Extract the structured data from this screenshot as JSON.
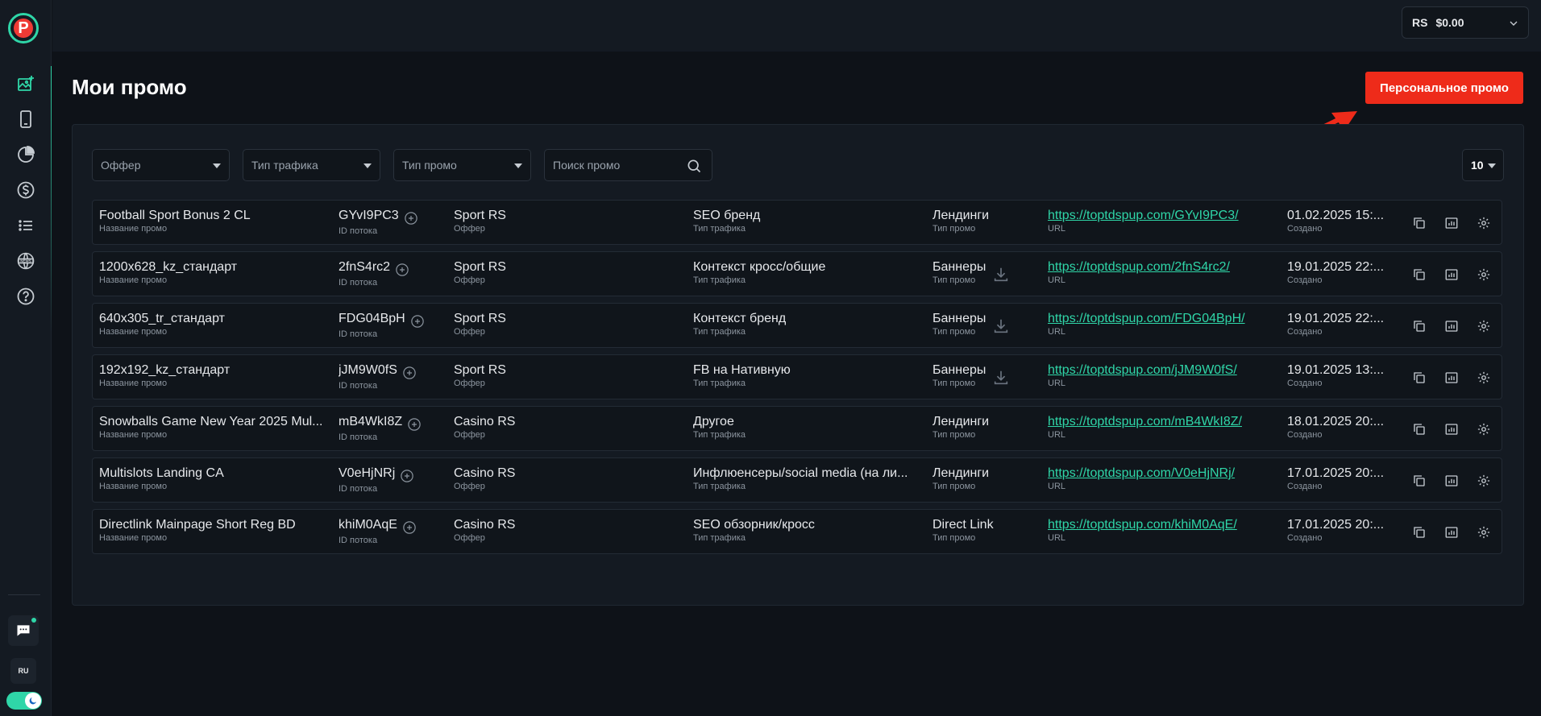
{
  "sidebar": {
    "logo_letter": "P",
    "nav": [
      "promo-icon",
      "mobile-icon",
      "pie-chart-icon",
      "dollar-icon",
      "list-icon",
      "news-icon",
      "help-icon"
    ],
    "lang": "RU"
  },
  "topbar": {
    "currency": "RS",
    "balance": "$0.00"
  },
  "page": {
    "title": "Мои промо",
    "personal_promo_button": "Персональное промо"
  },
  "filters": {
    "offer_placeholder": "Оффер",
    "traffic_placeholder": "Тип трафика",
    "promo_type_placeholder": "Тип промо",
    "search_placeholder": "Поиск промо",
    "per_page": "10"
  },
  "labels": {
    "name": "Название промо",
    "stream_id": "ID потока",
    "offer": "Оффер",
    "traffic": "Тип трафика",
    "promo_type": "Тип промо",
    "url": "URL",
    "created": "Создано"
  },
  "rows": [
    {
      "name": "Football Sport Bonus 2 CL",
      "id": "GYvI9PC3",
      "offer": "Sport RS",
      "traffic": "SEO бренд",
      "type": "Лендинги",
      "download": false,
      "url": "https://toptdspup.com/GYvI9PC3/",
      "date": "01.02.2025 15:..."
    },
    {
      "name": "1200x628_kz_стандарт",
      "id": "2fnS4rc2",
      "offer": "Sport RS",
      "traffic": "Контекст кросс/общие",
      "type": "Баннеры",
      "download": true,
      "url": "https://toptdspup.com/2fnS4rc2/",
      "date": "19.01.2025 22:..."
    },
    {
      "name": "640x305_tr_стандарт",
      "id": "FDG04BpH",
      "offer": "Sport RS",
      "traffic": "Контекст бренд",
      "type": "Баннеры",
      "download": true,
      "url": "https://toptdspup.com/FDG04BpH/",
      "date": "19.01.2025 22:..."
    },
    {
      "name": "192x192_kz_стандарт",
      "id": "jJM9W0fS",
      "offer": "Sport RS",
      "traffic": "FB на Нативную",
      "type": "Баннеры",
      "download": true,
      "url": "https://toptdspup.com/jJM9W0fS/",
      "date": "19.01.2025 13:..."
    },
    {
      "name": "Snowballs Game New Year 2025 Mul...",
      "id": "mB4WkI8Z",
      "offer": "Casino RS",
      "traffic": "Другое",
      "type": "Лендинги",
      "download": false,
      "url": "https://toptdspup.com/mB4WkI8Z/",
      "date": "18.01.2025 20:..."
    },
    {
      "name": "Multislots Landing CA",
      "id": "V0eHjNRj",
      "offer": "Casino RS",
      "traffic": "Инфлюенсеры/social media (на ли...",
      "type": "Лендинги",
      "download": false,
      "url": "https://toptdspup.com/V0eHjNRj/",
      "date": "17.01.2025 20:..."
    },
    {
      "name": "Directlink Mainpage Short Reg BD",
      "id": "khiM0AqE",
      "offer": "Casino RS",
      "traffic": "SEO обзорник/кросс",
      "type": "Direct Link",
      "download": false,
      "url": "https://toptdspup.com/khiM0AqE/",
      "date": "17.01.2025 20:..."
    }
  ],
  "colors": {
    "accent": "#2fd6a8",
    "primary_button": "#ee2b1a",
    "background": "#0e1218",
    "panel": "#141a22"
  }
}
